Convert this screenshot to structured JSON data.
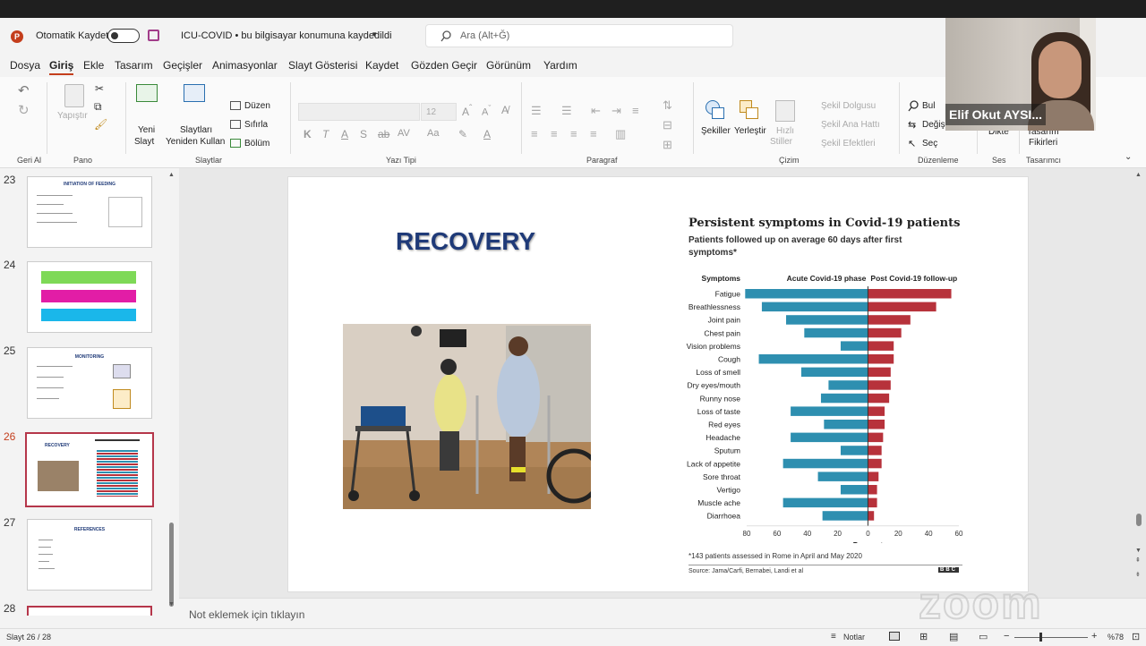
{
  "titlebar": {
    "autosave_label": "Otomatik Kaydet",
    "doc_title": "ICU-COVID • bu bilgisayar konumuna kaydedildi",
    "search_placeholder": "Ara (Alt+Ğ)"
  },
  "menu": [
    "Dosya",
    "Giriş",
    "Ekle",
    "Tasarım",
    "Geçişler",
    "Animasyonlar",
    "Slayt Gösterisi",
    "Kaydet",
    "Gözden Geçir",
    "Görünüm",
    "Yardım"
  ],
  "ribbon": {
    "geri_al": "Geri Al",
    "pano": "Pano",
    "yapistir": "Yapıştır",
    "yeni_slayt": "Yeni",
    "yeni_slayt2": "Slayt",
    "reuse1": "Slaytları",
    "reuse2": "Yeniden Kullan",
    "duzen": "Düzen",
    "sifirla": "Sıfırla",
    "bolum": "Bölüm",
    "slaytlar": "Slaytlar",
    "font_size": "12",
    "yazi_tipi": "Yazı Tipi",
    "paragraf": "Paragraf",
    "sekiller": "Şekiller",
    "yerlestir": "Yerleştir",
    "hizli": "Hızlı",
    "stiller": "Stiller",
    "sekil_dolgusu": "Şekil Dolgusu",
    "sekil_ana_hatti": "Şekil Ana Hattı",
    "sekil_efektleri": "Şekil Efektleri",
    "cizim": "Çizim",
    "bul": "Bul",
    "degis": "Değiş",
    "sec": "Seç",
    "duzenleme": "Düzenleme",
    "dikte": "Dikte",
    "ses": "Ses",
    "tasarim1": "Tasarım",
    "tasarim2": "Fikirleri",
    "tasarimci": "Tasarımcı"
  },
  "video": {
    "participant_name": "Elif Okut AYSI..."
  },
  "thumbnails": [
    {
      "num": "23",
      "title": "INITIATION OF FEEDING"
    },
    {
      "num": "24",
      "title": ""
    },
    {
      "num": "25",
      "title": "MONITORING"
    },
    {
      "num": "26",
      "title": "RECOVERY"
    },
    {
      "num": "27",
      "title": "REFERENCES"
    },
    {
      "num": "28",
      "title": ""
    }
  ],
  "slide": {
    "title": "RECOVERY",
    "chart_title": "Persistent symptoms in Covid-19 patients",
    "chart_subtitle1": "Patients followed up on average 60 days after first",
    "chart_subtitle2": "symptoms*",
    "col_symptoms": "Symptoms",
    "col_acute": "Acute Covid-19 phase",
    "col_post": "Post Covid-19 follow-up",
    "axis_label": "Per cent",
    "footnote": "*143 patients assessed in Rome in April and May 2020",
    "source": "Source: Jama/Carfi, Bernabei, Landi et al",
    "brand": "BBC"
  },
  "chart_data": {
    "type": "bar",
    "title": "Persistent symptoms in Covid-19 patients",
    "subtitle": "Patients followed up on average 60 days after first symptoms*",
    "xlabel": "Per cent",
    "xlim": [
      -80,
      60
    ],
    "x_ticks": [
      "80",
      "60",
      "40",
      "20",
      "0",
      "20",
      "40",
      "60"
    ],
    "categories": [
      "Fatigue",
      "Breathlessness",
      "Joint pain",
      "Chest pain",
      "Vision problems",
      "Cough",
      "Loss of smell",
      "Dry eyes/mouth",
      "Runny nose",
      "Loss of taste",
      "Red eyes",
      "Headache",
      "Sputum",
      "Lack of appetite",
      "Sore throat",
      "Vertigo",
      "Muscle ache",
      "Diarrhoea"
    ],
    "series": [
      {
        "name": "Acute Covid-19 phase",
        "color": "#2e8fb0",
        "values": [
          81,
          70,
          54,
          42,
          18,
          72,
          44,
          26,
          31,
          51,
          29,
          51,
          18,
          56,
          33,
          18,
          56,
          30
        ]
      },
      {
        "name": "Post Covid-19 follow-up",
        "color": "#b7323b",
        "values": [
          55,
          45,
          28,
          22,
          17,
          17,
          15,
          15,
          14,
          11,
          11,
          10,
          9,
          9,
          7,
          6,
          6,
          4
        ]
      }
    ]
  },
  "notes_placeholder": "Not eklemek için tıklayın",
  "status": {
    "slide_counter": "Slayt 26 / 28",
    "notes_label": "Notlar",
    "zoom": "%78"
  }
}
